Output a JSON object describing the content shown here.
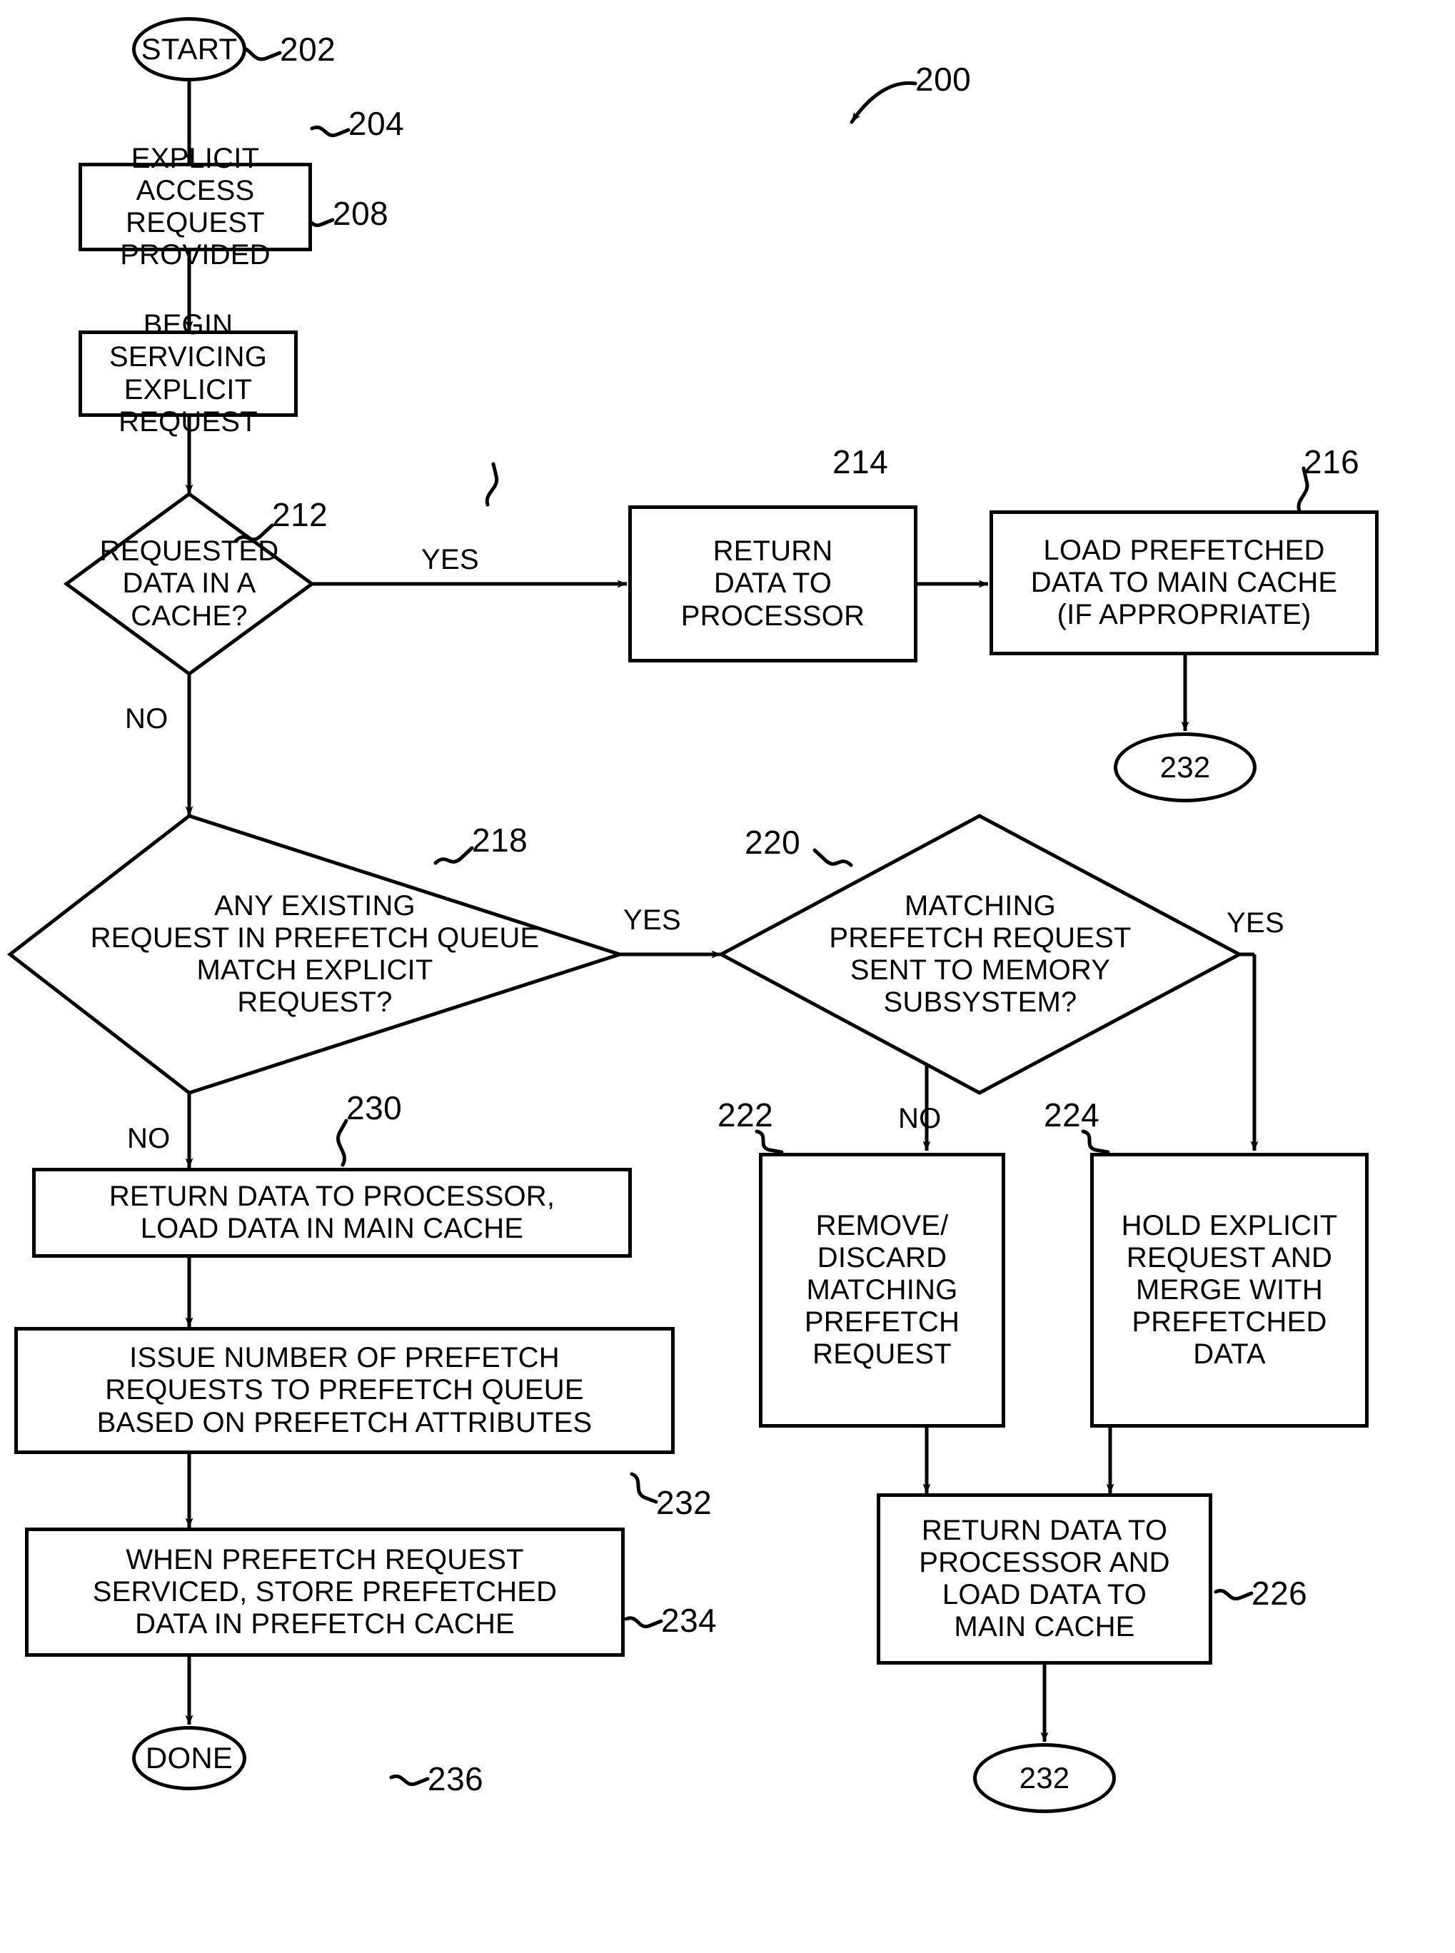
{
  "figure": {
    "ref": "200",
    "type": "patent-flowchart"
  },
  "nodes": {
    "start": {
      "ref": "202",
      "text": "START"
    },
    "n204": {
      "ref": "204",
      "line1": "EXPLICIT ACCESS",
      "line2": "REQUEST PROVIDED"
    },
    "n208": {
      "ref": "208",
      "line1": "BEGIN SERVICING",
      "line2": "EXPLICIT REQUEST"
    },
    "d212": {
      "ref": "212",
      "line1": "REQUESTED",
      "line2": "DATA IN A",
      "line3": "CACHE?"
    },
    "n214": {
      "ref": "214",
      "line1": "RETURN",
      "line2": "DATA TO",
      "line3": "PROCESSOR"
    },
    "n216": {
      "ref": "216",
      "line1": "LOAD PREFETCHED",
      "line2": "DATA TO MAIN CACHE",
      "line3": "(IF APPROPRIATE)"
    },
    "c232a": {
      "text": "232"
    },
    "d218": {
      "ref": "218",
      "line1": "ANY EXISTING",
      "line2": "REQUEST IN PREFETCH QUEUE",
      "line3": "MATCH EXPLICIT",
      "line4": "REQUEST?"
    },
    "d220": {
      "ref": "220",
      "line1": "MATCHING",
      "line2": "PREFETCH REQUEST",
      "line3": "SENT TO MEMORY",
      "line4": "SUBSYSTEM?"
    },
    "n230": {
      "ref": "230",
      "line1": "RETURN DATA TO PROCESSOR,",
      "line2": "LOAD DATA IN MAIN CACHE"
    },
    "n232box": {
      "ref": "232",
      "line1": "ISSUE NUMBER OF PREFETCH",
      "line2": "REQUESTS TO PREFETCH QUEUE",
      "line3": "BASED ON PREFETCH ATTRIBUTES"
    },
    "n234": {
      "ref": "234",
      "line1": "WHEN PREFETCH REQUEST",
      "line2": "SERVICED, STORE PREFETCHED",
      "line3": "DATA IN PREFETCH CACHE"
    },
    "done": {
      "ref": "236",
      "text": "DONE"
    },
    "n222": {
      "ref": "222",
      "line1": "REMOVE/",
      "line2": "DISCARD",
      "line3": "MATCHING",
      "line4": "PREFETCH",
      "line5": "REQUEST"
    },
    "n224": {
      "ref": "224",
      "line1": "HOLD EXPLICIT",
      "line2": "REQUEST AND",
      "line3": "MERGE WITH",
      "line4": "PREFETCHED",
      "line5": "DATA"
    },
    "n226": {
      "ref": "226",
      "line1": "RETURN DATA TO",
      "line2": "PROCESSOR AND",
      "line3": "LOAD DATA TO",
      "line4": "MAIN CACHE"
    },
    "c232b": {
      "text": "232"
    }
  },
  "edge_labels": {
    "d212_yes": "YES",
    "d212_no": "NO",
    "d218_yes": "YES",
    "d218_no": "NO",
    "d220_yes": "YES",
    "d220_no": "NO"
  },
  "colors": {
    "stroke": "#000000",
    "background": "#ffffff"
  }
}
